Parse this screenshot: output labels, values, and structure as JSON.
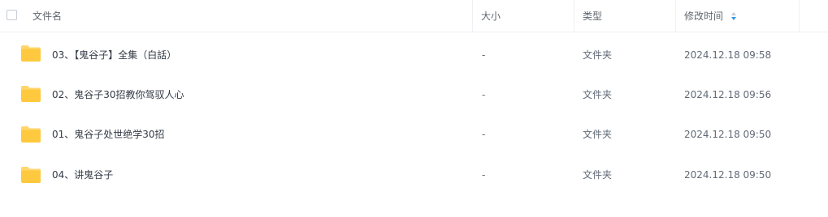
{
  "header": {
    "col_name": "文件名",
    "col_size": "大小",
    "col_type": "类型",
    "col_modified": "修改时间"
  },
  "rows": [
    {
      "name": "03、【鬼谷子】全集（白話）",
      "size": "-",
      "type": "文件夹",
      "modified": "2024.12.18 09:58"
    },
    {
      "name": "02、鬼谷子30招教你驾驭人心",
      "size": "-",
      "type": "文件夹",
      "modified": "2024.12.18 09:56"
    },
    {
      "name": "01、鬼谷子处世绝学30招",
      "size": "-",
      "type": "文件夹",
      "modified": "2024.12.18 09:50"
    },
    {
      "name": "04、讲鬼谷子",
      "size": "-",
      "type": "文件夹",
      "modified": "2024.12.18 09:50"
    }
  ],
  "icons": {
    "folder": "folder-icon",
    "sort": "sort-icon"
  },
  "colors": {
    "folder_top": "#ffd66b",
    "folder_body": "#ffc93f",
    "sort_accent": "#2d9be6"
  }
}
